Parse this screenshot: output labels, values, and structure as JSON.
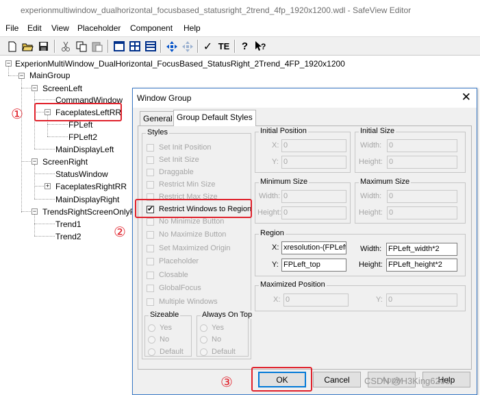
{
  "window": {
    "title": "experionmultiwindow_dualhorizontal_focusbased_statusright_2trend_4fp_1920x1200.wdl - SafeView Editor"
  },
  "menu": [
    "File",
    "Edit",
    "View",
    "Placeholder",
    "Component",
    "Help"
  ],
  "toolbar": {
    "icons": [
      "new-file-icon",
      "open-folder-icon",
      "save-icon",
      "cut-icon",
      "copy-icon",
      "paste-icon",
      "window-layout-icon",
      "split-horizontal-icon",
      "split-vertical-icon",
      "move-arrows-icon",
      "move-arrows-disabled-icon",
      "checkmark-icon",
      "text-edit-icon",
      "help-icon",
      "context-help-icon"
    ],
    "check_glyph": "✓",
    "te_label": "TE",
    "help_glyph": "?"
  },
  "tree": {
    "root": "ExperionMultiWindow_DualHorizontal_FocusBased_StatusRight_2Trend_4FP_1920x1200",
    "main_group": "MainGroup",
    "screen_left": "ScreenLeft",
    "command_window": "CommandWindow",
    "faceplates_left": "FaceplatesLeftRR",
    "fp_left": "FPLeft",
    "fp_left2": "FPLeft2",
    "main_display_left": "MainDisplayLeft",
    "screen_right": "ScreenRight",
    "status_window": "StatusWindow",
    "faceplates_right": "FaceplatesRightRR",
    "main_display_right": "MainDisplayRight",
    "trends_right": "TrendsRightScreenOnlyRR",
    "trend1": "Trend1",
    "trend2": "Trend2",
    "expanded_glyph": "−",
    "collapsed_glyph": "+"
  },
  "annotations": {
    "c1": "①",
    "c2": "②",
    "c3": "③"
  },
  "dialog": {
    "title": "Window Group",
    "close_glyph": "✕",
    "tabs": [
      "General",
      "Group Default Styles"
    ],
    "active_tab": "Group Default Styles",
    "styles": {
      "label": "Styles",
      "items": [
        {
          "label": "Set Init Position",
          "checked": false,
          "enabled": false
        },
        {
          "label": "Set Init Size",
          "checked": false,
          "enabled": false
        },
        {
          "label": "Draggable",
          "checked": false,
          "enabled": false
        },
        {
          "label": "Restrict Min Size",
          "checked": false,
          "enabled": false
        },
        {
          "label": "Restrict Max Size",
          "checked": false,
          "enabled": false
        },
        {
          "label": "Restrict Windows to Region",
          "checked": true,
          "enabled": true
        },
        {
          "label": "No Minimize Button",
          "checked": false,
          "enabled": false
        },
        {
          "label": "No Maximize Button",
          "checked": false,
          "enabled": false
        },
        {
          "label": "Set Maximized Origin",
          "checked": false,
          "enabled": false
        },
        {
          "label": "Placeholder",
          "checked": false,
          "enabled": false
        },
        {
          "label": "Closable",
          "checked": false,
          "enabled": false
        },
        {
          "label": "GlobalFocus",
          "checked": false,
          "enabled": false
        },
        {
          "label": "Multiple Windows",
          "checked": false,
          "enabled": false
        }
      ]
    },
    "sizeable": {
      "label": "Sizeable",
      "options": [
        "Yes",
        "No",
        "Default"
      ]
    },
    "always_on_top": {
      "label": "Always On Top",
      "options": [
        "Yes",
        "No",
        "Default"
      ]
    },
    "initial_position": {
      "label": "Initial Position",
      "x_label": "X:",
      "x": "0",
      "y_label": "Y:",
      "y": "0"
    },
    "initial_size": {
      "label": "Initial Size",
      "w_label": "Width:",
      "w": "0",
      "h_label": "Height:",
      "h": "0"
    },
    "minimum_size": {
      "label": "Minimum Size",
      "w_label": "Width:",
      "w": "0",
      "h_label": "Height:",
      "h": "0"
    },
    "maximum_size": {
      "label": "Maximum Size",
      "w_label": "Width:",
      "w": "0",
      "h_label": "Height:",
      "h": "0"
    },
    "region": {
      "label": "Region",
      "x_label": "X:",
      "x": "xresolution-(FPLeft_",
      "y_label": "Y:",
      "y": "FPLeft_top",
      "w_label": "Width:",
      "w": "FPLeft_width*2",
      "h_label": "Height:",
      "h": "FPLeft_height*2"
    },
    "maximized_position": {
      "label": "Maximized Position",
      "x_label": "X:",
      "x": "0",
      "y_label": "Y:",
      "y": "0"
    },
    "buttons": {
      "ok": "OK",
      "cancel": "Cancel",
      "apply": "Apply",
      "help": "Help"
    }
  },
  "watermark": "CSDN @H3King6203",
  "colors": {
    "annotation": "#e0202a",
    "dialog_border": "#3a79c6",
    "default_button": "#0078d7"
  }
}
